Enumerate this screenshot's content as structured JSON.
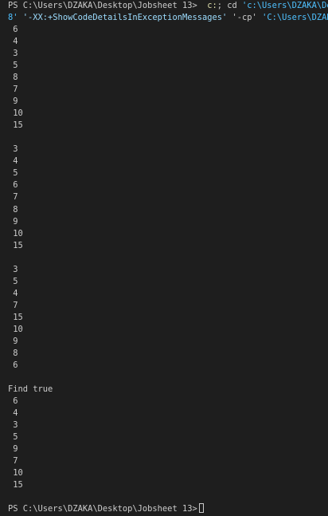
{
  "terminal": {
    "prompt": "PS C:\\Users\\DZAKA\\Desktop\\Jobsheet 13>",
    "command_line_1": {
      "part_keyword": "c:",
      "part_text": "; cd ",
      "part_string": "'c:\\Users\\DZAKA\\Desk"
    },
    "command_line_2": {
      "part_string_a": "8'",
      "part_arg": " '-XX:+ShowCodeDetailsInExceptionMessages'",
      "part_text": " '-cp' ",
      "part_string_b": "'C:\\Users\\DZAKA\\"
    },
    "block1": [
      "6",
      "4",
      "3",
      "5",
      "8",
      "7",
      "9",
      "10",
      "15"
    ],
    "block2": [
      "3",
      "4",
      "5",
      "6",
      "7",
      "8",
      "9",
      "10",
      "15"
    ],
    "block3": [
      "3",
      "5",
      "4",
      "7",
      "15",
      "10",
      "9",
      "8",
      "6"
    ],
    "find_label": "Find true",
    "block4": [
      "6",
      "4",
      "3",
      "5",
      "9",
      "7",
      "10",
      "15"
    ],
    "final_prompt": "PS C:\\Users\\DZAKA\\Desktop\\Jobsheet 13>"
  }
}
